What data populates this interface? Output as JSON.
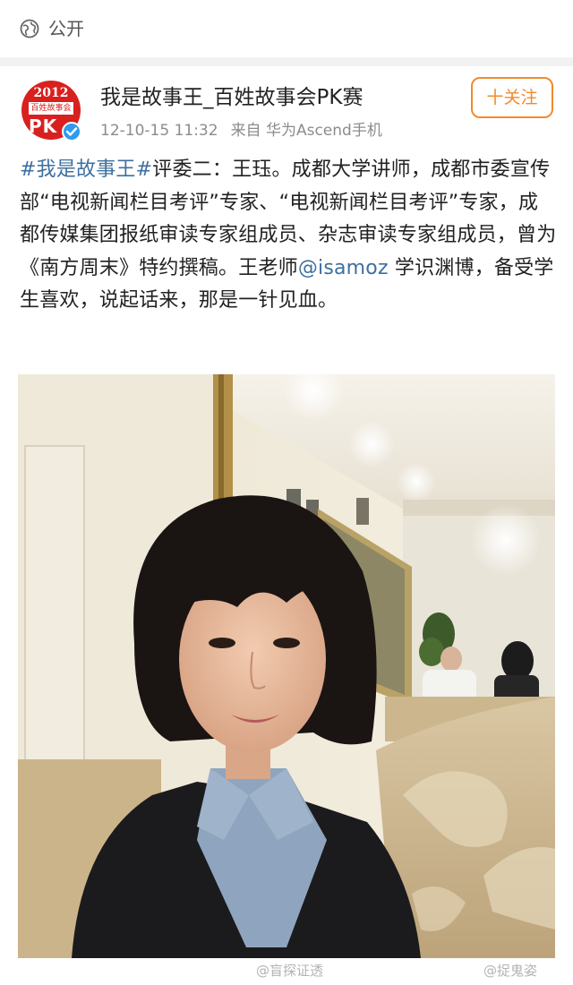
{
  "top_bar": {
    "icon": "globe-icon",
    "label": "公开"
  },
  "post": {
    "author": {
      "name": "我是故事王_百姓故事会PK赛",
      "avatar": {
        "year": "2012",
        "subtitle": "百姓故事会",
        "letters": "PK"
      },
      "verified_icon": "verified-badge-icon"
    },
    "time": "12-10-15 11:32",
    "source": "来自 华为Ascend手机",
    "follow_label": "十关注",
    "text": {
      "hashtag": "#我是故事王#",
      "part1": "评委二：王珏。成都大学讲师，成都市委宣传部“电视新闻栏目考评”专家、“电视新闻栏目考评”专家，成都传媒集团报纸审读专家组成员、杂志审读专家组成员，曾为《南方周末》特约撰稿。王老师",
      "mention": "@isamoz",
      "part2": " 学识渊博，备受学生喜欢，说起话来，那是一针见血。"
    }
  },
  "watermarks": {
    "left": "@盲探证透",
    "right": "@捉鬼姿"
  },
  "colors": {
    "link": "#3e6fa0",
    "follow": "#f28a2c",
    "verified": "#2d9bef",
    "avatar_red": "#d8201f"
  }
}
